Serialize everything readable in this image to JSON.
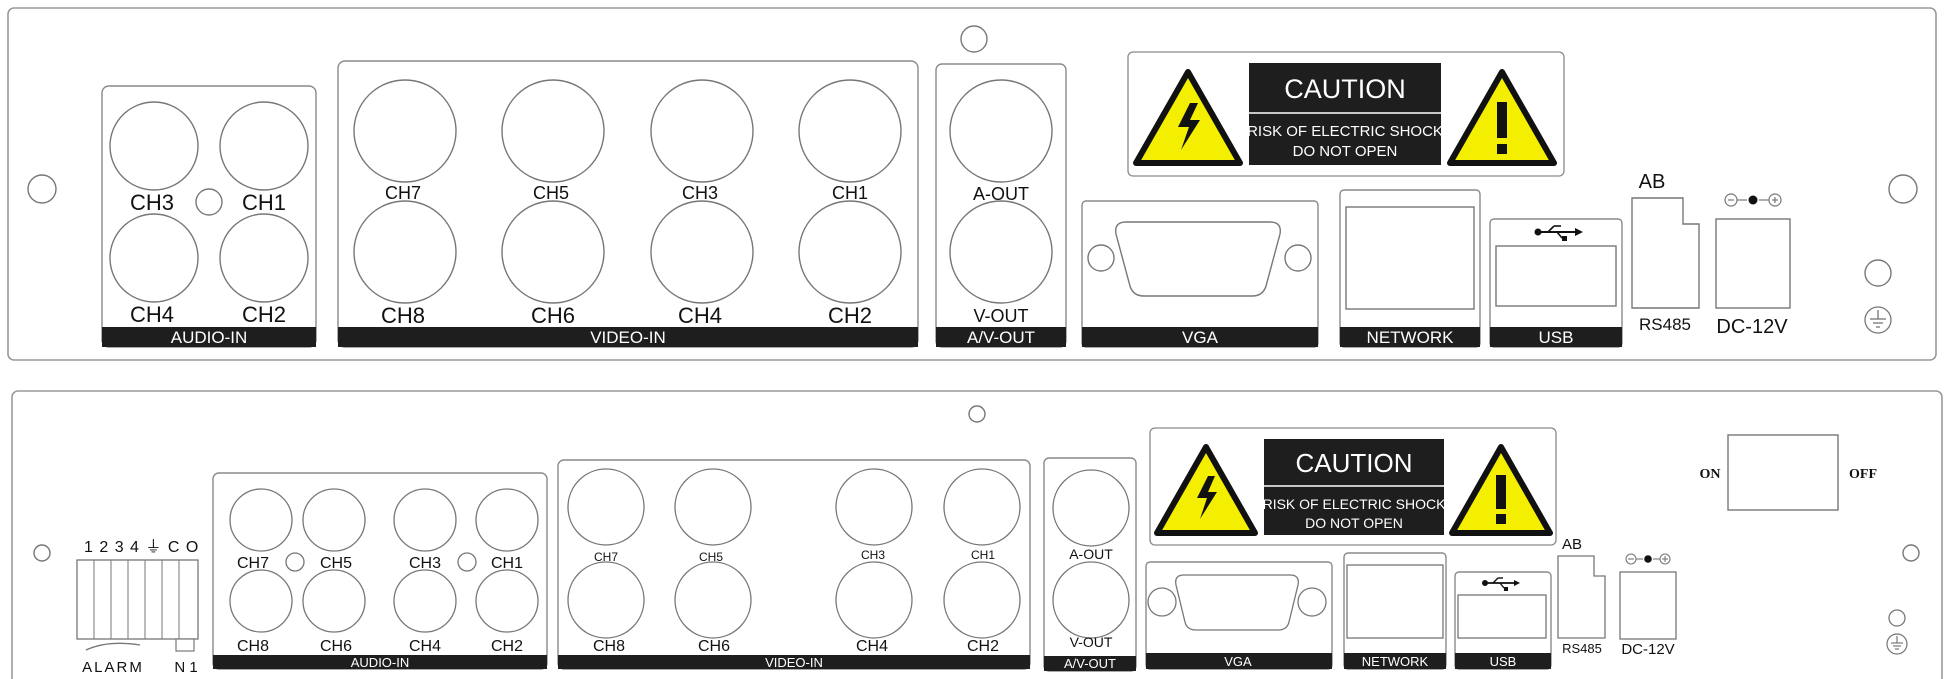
{
  "panel_a": {
    "audio_in": {
      "label": "AUDIO-IN",
      "channels": [
        "CH3",
        "CH1",
        "CH4",
        "CH2"
      ]
    },
    "video_in": {
      "label": "VIDEO-IN",
      "channels": [
        "CH7",
        "CH5",
        "CH3",
        "CH1",
        "CH8",
        "CH6",
        "CH4",
        "CH2"
      ]
    },
    "av_out": {
      "label": "A/V-OUT",
      "a_out": "A-OUT",
      "v_out": "V-OUT"
    },
    "caution": {
      "title": "CAUTION",
      "line1": "RISK OF ELECTRIC SHOCK",
      "line2": "DO NOT OPEN"
    },
    "vga": "VGA",
    "network": "NETWORK",
    "usb": "USB",
    "rs485": {
      "top": "AB",
      "label": "RS485"
    },
    "dc": "DC-12V"
  },
  "panel_b": {
    "alarm": {
      "pins": "1 2 3 4 ⏚ C O",
      "label": "ALARM",
      "n1": "N 1"
    },
    "audio_in": {
      "label": "AUDIO-IN",
      "channels": [
        "CH7",
        "CH5",
        "CH3",
        "CH1",
        "CH8",
        "CH6",
        "CH4",
        "CH2"
      ]
    },
    "video_in": {
      "label": "VIDEO-IN",
      "channels": [
        "CH7",
        "CH5",
        "CH3",
        "CH1",
        "CH8",
        "CH6",
        "CH4",
        "CH2"
      ]
    },
    "av_out": {
      "label": "A/V-OUT",
      "a_out": "A-OUT",
      "v_out": "V-OUT"
    },
    "caution": {
      "title": "CAUTION",
      "line1": "RISK OF ELECTRIC SHOCK",
      "line2": "DO NOT OPEN"
    },
    "vga": "VGA",
    "network": "NETWORK",
    "usb": "USB",
    "rs485": {
      "top": "AB",
      "label": "RS485"
    },
    "dc": "DC-12V",
    "switch": {
      "on": "ON",
      "off": "OFF"
    }
  },
  "colors": {
    "outline": "#8a8a8a",
    "label_bar": "#1e1e1e",
    "caution_yellow": "#f4ee00"
  }
}
